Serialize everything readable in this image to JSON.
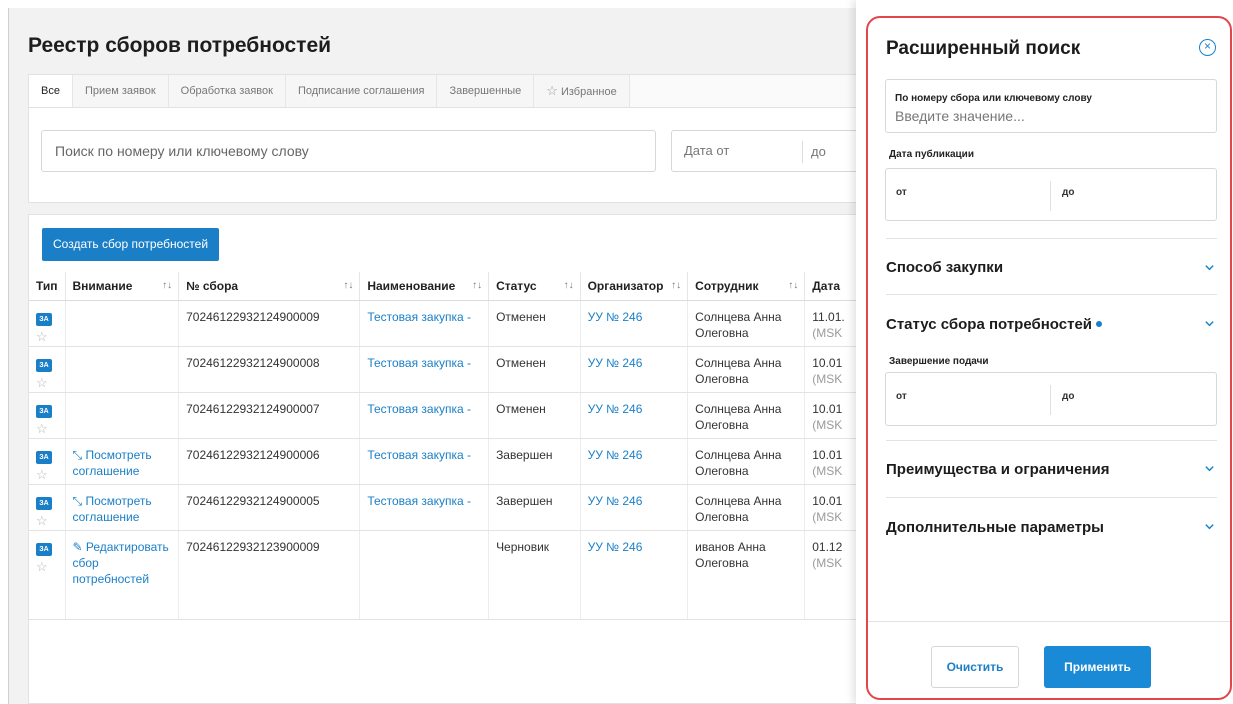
{
  "page": {
    "title": "Реестр сборов потребностей",
    "tabs": [
      {
        "label": "Все"
      },
      {
        "label": "Прием заявок"
      },
      {
        "label": "Обработка заявок"
      },
      {
        "label": "Подписание соглашения"
      },
      {
        "label": "Завершенные"
      },
      {
        "label": "Избранное"
      }
    ],
    "search_placeholder": "Поиск по номеру или ключевому слову",
    "date_from_placeholder": "Дата от",
    "date_to_placeholder": "до",
    "create_button": "Создать сбор потребностей"
  },
  "table": {
    "columns": [
      "Тип",
      "Внимание",
      "№ сбора",
      "Наименование",
      "Статус",
      "Организатор",
      "Сотрудник",
      "Дата"
    ],
    "rows": [
      {
        "badge": "ЗА",
        "attention_icon": "",
        "attention": "",
        "number": "70246122932124900009",
        "name": "Тестовая закупка -",
        "status": "Отменен",
        "organizer": "УУ № 246",
        "employee": "Солнцева Анна Олеговна",
        "date": "11.01.",
        "date_sub": "(MSK"
      },
      {
        "badge": "ЗА",
        "attention_icon": "",
        "attention": "",
        "number": "70246122932124900008",
        "name": "Тестовая закупка -",
        "status": "Отменен",
        "organizer": "УУ № 246",
        "employee": "Солнцева Анна Олеговна",
        "date": "10.01",
        "date_sub": "(MSK"
      },
      {
        "badge": "ЗА",
        "attention_icon": "",
        "attention": "",
        "number": "70246122932124900007",
        "name": "Тестовая закупка -",
        "status": "Отменен",
        "organizer": "УУ № 246",
        "employee": "Солнцева Анна Олеговна",
        "date": "10.01",
        "date_sub": "(MSK"
      },
      {
        "badge": "ЗА",
        "attention_icon": "⤡",
        "attention": "Посмотреть соглашение",
        "number": "70246122932124900006",
        "name": "Тестовая закупка -",
        "status": "Завершен",
        "organizer": "УУ № 246",
        "employee": "Солнцева Анна Олеговна",
        "date": "10.01",
        "date_sub": "(MSK"
      },
      {
        "badge": "ЗА",
        "attention_icon": "⤡",
        "attention": "Посмотреть соглашение",
        "number": "70246122932124900005",
        "name": "Тестовая закупка -",
        "status": "Завершен",
        "organizer": "УУ № 246",
        "employee": "Солнцева Анна Олеговна",
        "date": "10.01",
        "date_sub": "(MSK"
      },
      {
        "badge": "ЗА",
        "attention_icon": "✎",
        "attention": "Редактировать сбор потребностей",
        "number": "70246122932123900009",
        "name": "",
        "status": "Черновик",
        "organizer": "УУ № 246",
        "employee": "иванов Анна Олеговна",
        "date": "01.12",
        "date_sub": "(MSK"
      }
    ]
  },
  "panel": {
    "title": "Расширенный поиск",
    "keyword_label": "По номеру сбора или ключевому слову",
    "keyword_placeholder": "Введите значение...",
    "pub_date_label": "Дата публикации",
    "from": "от",
    "to": "до",
    "sections": {
      "method": "Способ закупки",
      "status": "Статус сбора потребностей",
      "advantages": "Преимущества и ограничения",
      "extra": "Дополнительные параметры"
    },
    "deadline_label": "Завершение подачи",
    "clear_button": "Очистить",
    "apply_button": "Применить"
  },
  "colors": {
    "accent": "#1a7fc7",
    "highlight_outline": "#e0474c"
  }
}
